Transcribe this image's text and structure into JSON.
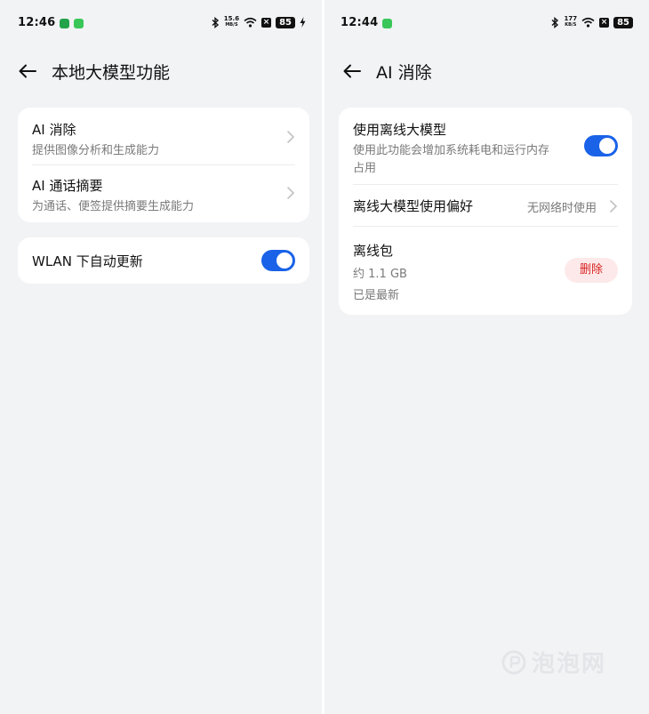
{
  "left_screen": {
    "status": {
      "time": "12:46",
      "speed_value": "15.6",
      "speed_unit": "MB/S",
      "battery": "85"
    },
    "header": {
      "title": "本地大模型功能"
    },
    "card1": {
      "items": [
        {
          "title": "AI 消除",
          "subtitle": "提供图像分析和生成能力"
        },
        {
          "title": "AI 通话摘要",
          "subtitle": "为通话、便签提供摘要生成能力"
        }
      ]
    },
    "card2": {
      "label": "WLAN 下自动更新",
      "toggle_on": true
    }
  },
  "right_screen": {
    "status": {
      "time": "12:44",
      "speed_value": "177",
      "speed_unit": "KB/S",
      "battery": "85"
    },
    "header": {
      "title": "AI 消除"
    },
    "card": {
      "offline_model": {
        "title": "使用离线大模型",
        "subtitle_line1": "使用此功能会增加系统耗电和运行内存",
        "subtitle_line2": "占用",
        "toggle_on": true
      },
      "preference": {
        "title": "离线大模型使用偏好",
        "value": "无网络时使用"
      },
      "package": {
        "title": "离线包",
        "size": "约 1.1 GB",
        "status": "已是最新",
        "delete_label": "删除"
      }
    }
  },
  "watermark": {
    "text": "泡泡网"
  },
  "colors": {
    "accent": "#1a62e8",
    "danger": "#d82424",
    "background": "#f2f3f5"
  }
}
